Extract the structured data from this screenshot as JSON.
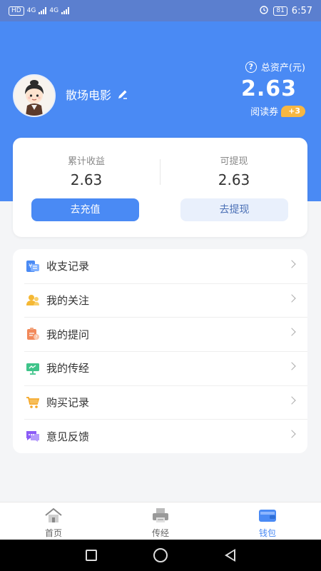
{
  "status_bar": {
    "left_badges": [
      "HD",
      "4G",
      "4G"
    ],
    "battery": "81",
    "time": "6:57"
  },
  "profile": {
    "username": "散场电影",
    "edit_icon": "edit-icon",
    "avatar_icon": "cartoon-avatar"
  },
  "assets": {
    "label": "总资产(元)",
    "value": "2.63",
    "coupon_label": "阅读券",
    "coupon_badge": "+3"
  },
  "earnings": {
    "total_label": "累计收益",
    "total_value": "2.63",
    "withdrawable_label": "可提现",
    "withdrawable_value": "2.63",
    "recharge_button": "去充值",
    "withdraw_button": "去提现"
  },
  "menu": {
    "items": [
      {
        "label": "收支记录",
        "icon": "ledger-icon"
      },
      {
        "label": "我的关注",
        "icon": "follow-icon"
      },
      {
        "label": "我的提问",
        "icon": "question-icon"
      },
      {
        "label": "我的传经",
        "icon": "share-icon"
      },
      {
        "label": "购买记录",
        "icon": "cart-icon"
      },
      {
        "label": "意见反馈",
        "icon": "feedback-icon"
      }
    ]
  },
  "tabs": [
    {
      "label": "首页",
      "icon": "home-icon",
      "active": false
    },
    {
      "label": "传经",
      "icon": "printer-icon",
      "active": false
    },
    {
      "label": "钱包",
      "icon": "wallet-icon",
      "active": true
    }
  ],
  "colors": {
    "primary": "#4a8af4",
    "accent_badge": "#f7b742",
    "page_bg": "#f4f5f7"
  }
}
